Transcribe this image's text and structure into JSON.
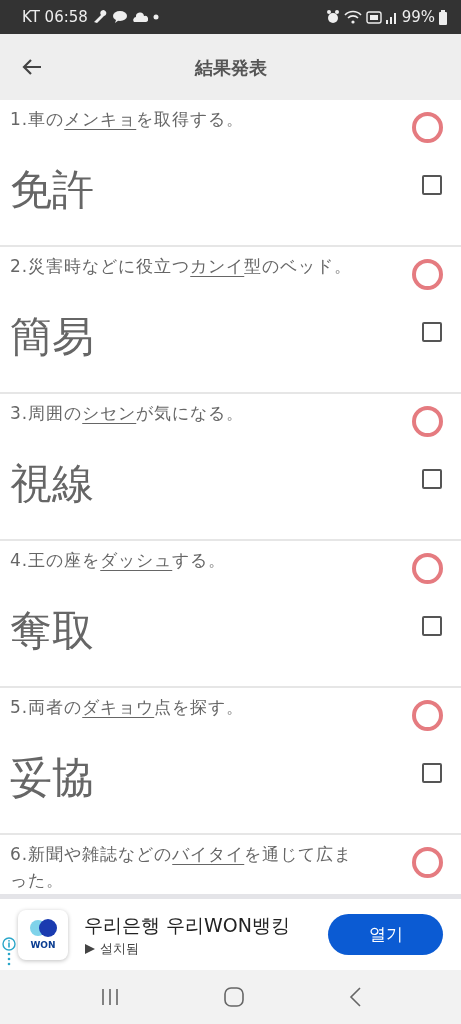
{
  "status_bar": {
    "carrier_time": "KT 06:58",
    "battery": "99%"
  },
  "app_bar": {
    "title": "結果発表"
  },
  "questions": [
    {
      "prefix": "1.車の",
      "underlined": "メンキョ",
      "suffix": "を取得する。",
      "answer": "免許",
      "correct": true,
      "checked": false
    },
    {
      "prefix": "2.災害時などに役立つ",
      "underlined": "カンイ",
      "suffix": "型のベッド。",
      "answer": "簡易",
      "correct": true,
      "checked": false
    },
    {
      "prefix": "3.周囲の",
      "underlined": "シセン",
      "suffix": "が気になる。",
      "answer": "視線",
      "correct": true,
      "checked": false
    },
    {
      "prefix": "4.王の座を",
      "underlined": "ダッシュ",
      "suffix": "する。",
      "answer": "奪取",
      "correct": true,
      "checked": false
    },
    {
      "prefix": "5.両者の",
      "underlined": "ダキョウ",
      "suffix": "点を探す。",
      "answer": "妥協",
      "correct": true,
      "checked": false
    },
    {
      "prefix": "6.新聞や雑誌などの",
      "underlined": "バイタイ",
      "suffix": "を通じて広まった。",
      "correct": true
    }
  ],
  "ad": {
    "logo_text": "WON",
    "title": "우리은행 우리WON뱅킹",
    "subtitle": "설치됨",
    "button": "열기"
  }
}
